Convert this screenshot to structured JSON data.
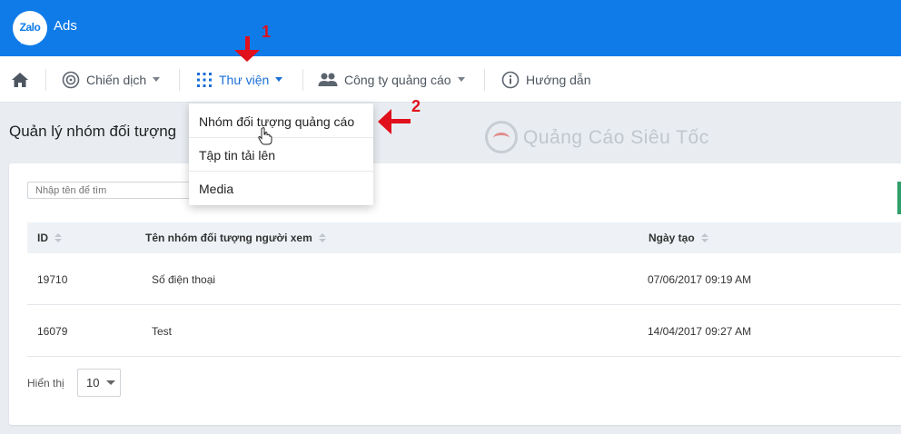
{
  "header": {
    "brand_logo_text": "Zalo",
    "brand_suffix": "Ads"
  },
  "nav": {
    "items": [
      {
        "label": "Chiến dịch",
        "icon": "target-icon"
      },
      {
        "label": "Thư viện",
        "icon": "grid-icon"
      },
      {
        "label": "Công ty quảng cáo",
        "icon": "people-icon"
      },
      {
        "label": "Hướng dẫn",
        "icon": "info-icon"
      }
    ],
    "home_icon": "home-icon"
  },
  "dropdown": {
    "items": [
      {
        "label": "Nhóm đối tượng quảng cáo"
      },
      {
        "label": "Tập tin tải lên"
      },
      {
        "label": "Media"
      }
    ]
  },
  "annotations": {
    "one": "1",
    "two": "2"
  },
  "page": {
    "title": "Quản lý nhóm đối tượng"
  },
  "watermark": {
    "text": "Quảng Cáo Siêu Tốc"
  },
  "search": {
    "placeholder": "Nhập tên để tìm"
  },
  "table": {
    "columns": [
      "ID",
      "Tên nhóm đối tượng người xem",
      "Ngày tạo"
    ],
    "rows": [
      {
        "id": "19710",
        "name": "Số điện thoại",
        "created": "07/06/2017 09:19 AM"
      },
      {
        "id": "16079",
        "name": "Test",
        "created": "14/04/2017 09:27 AM"
      }
    ]
  },
  "pagination": {
    "show_label": "Hiển thị",
    "page_size": "10"
  },
  "colors": {
    "header_blue": "#0f7be8",
    "active_blue": "#1a6fd6",
    "annotation_red": "#e0101c"
  }
}
